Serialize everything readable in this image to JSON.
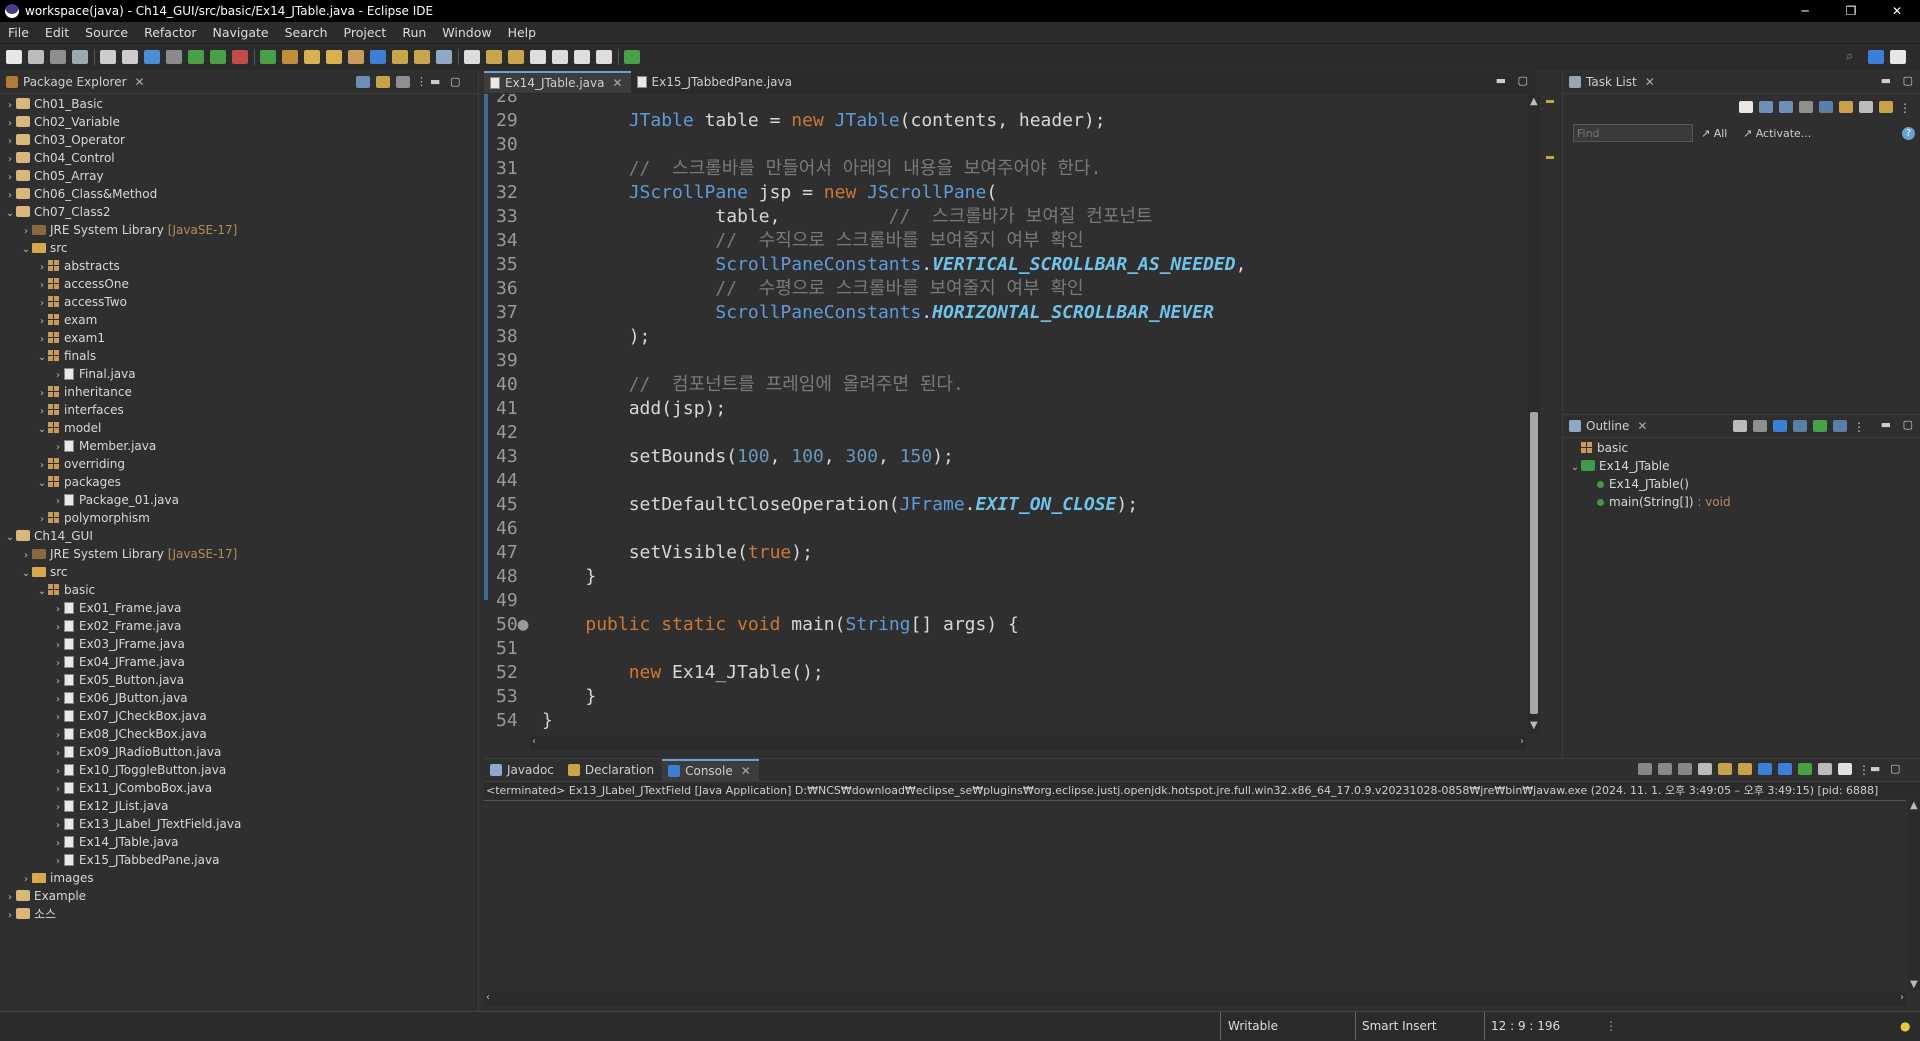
{
  "window": {
    "title": "workspace(java) - Ch14_GUI/src/basic/Ex14_JTable.java - Eclipse IDE",
    "minimize": "─",
    "restore": "❐",
    "close": "✕"
  },
  "menu": [
    "File",
    "Edit",
    "Source",
    "Refactor",
    "Navigate",
    "Search",
    "Project",
    "Run",
    "Window",
    "Help"
  ],
  "package_explorer": {
    "title": "Package Explorer",
    "rows": [
      {
        "indent": 0,
        "arrow": "›",
        "icon": "proj",
        "label": "Ch01_Basic"
      },
      {
        "indent": 0,
        "arrow": "›",
        "icon": "proj",
        "label": "Ch02_Variable"
      },
      {
        "indent": 0,
        "arrow": "›",
        "icon": "proj",
        "label": "Ch03_Operator"
      },
      {
        "indent": 0,
        "arrow": "›",
        "icon": "proj",
        "label": "Ch04_Control"
      },
      {
        "indent": 0,
        "arrow": "›",
        "icon": "proj",
        "label": "Ch05_Array"
      },
      {
        "indent": 0,
        "arrow": "›",
        "icon": "proj",
        "label": "Ch06_Class&Method"
      },
      {
        "indent": 0,
        "arrow": "⌄",
        "icon": "proj",
        "label": "Ch07_Class2"
      },
      {
        "indent": 1,
        "arrow": "›",
        "icon": "lib",
        "label": "JRE System Library",
        "suffix": "[JavaSE-17]"
      },
      {
        "indent": 1,
        "arrow": "⌄",
        "icon": "folder",
        "label": "src"
      },
      {
        "indent": 2,
        "arrow": "›",
        "icon": "pkg",
        "label": "abstracts"
      },
      {
        "indent": 2,
        "arrow": "›",
        "icon": "pkg",
        "label": "accessOne"
      },
      {
        "indent": 2,
        "arrow": "›",
        "icon": "pkg",
        "label": "accessTwo"
      },
      {
        "indent": 2,
        "arrow": "›",
        "icon": "pkg",
        "label": "exam"
      },
      {
        "indent": 2,
        "arrow": "›",
        "icon": "pkg",
        "label": "exam1"
      },
      {
        "indent": 2,
        "arrow": "⌄",
        "icon": "pkg",
        "label": "finals"
      },
      {
        "indent": 3,
        "arrow": "›",
        "icon": "java",
        "label": "Final.java"
      },
      {
        "indent": 2,
        "arrow": "›",
        "icon": "pkg",
        "label": "inheritance"
      },
      {
        "indent": 2,
        "arrow": "›",
        "icon": "pkg",
        "label": "interfaces"
      },
      {
        "indent": 2,
        "arrow": "⌄",
        "icon": "pkg",
        "label": "model"
      },
      {
        "indent": 3,
        "arrow": "›",
        "icon": "java",
        "label": "Member.java"
      },
      {
        "indent": 2,
        "arrow": "›",
        "icon": "pkg",
        "label": "overriding"
      },
      {
        "indent": 2,
        "arrow": "⌄",
        "icon": "pkg",
        "label": "packages"
      },
      {
        "indent": 3,
        "arrow": "›",
        "icon": "java",
        "label": "Package_01.java"
      },
      {
        "indent": 2,
        "arrow": "›",
        "icon": "pkg",
        "label": "polymorphism"
      },
      {
        "indent": 0,
        "arrow": "⌄",
        "icon": "proj",
        "label": "Ch14_GUI"
      },
      {
        "indent": 1,
        "arrow": "›",
        "icon": "lib",
        "label": "JRE System Library",
        "suffix": "[JavaSE-17]"
      },
      {
        "indent": 1,
        "arrow": "⌄",
        "icon": "folder",
        "label": "src"
      },
      {
        "indent": 2,
        "arrow": "⌄",
        "icon": "pkg",
        "label": "basic"
      },
      {
        "indent": 3,
        "arrow": "›",
        "icon": "java",
        "label": "Ex01_Frame.java"
      },
      {
        "indent": 3,
        "arrow": "›",
        "icon": "java",
        "label": "Ex02_Frame.java"
      },
      {
        "indent": 3,
        "arrow": "›",
        "icon": "java",
        "label": "Ex03_JFrame.java"
      },
      {
        "indent": 3,
        "arrow": "›",
        "icon": "java",
        "label": "Ex04_JFrame.java"
      },
      {
        "indent": 3,
        "arrow": "›",
        "icon": "java",
        "label": "Ex05_Button.java"
      },
      {
        "indent": 3,
        "arrow": "›",
        "icon": "java",
        "label": "Ex06_JButton.java"
      },
      {
        "indent": 3,
        "arrow": "›",
        "icon": "java",
        "label": "Ex07_JCheckBox.java"
      },
      {
        "indent": 3,
        "arrow": "›",
        "icon": "java",
        "label": "Ex08_JCheckBox.java"
      },
      {
        "indent": 3,
        "arrow": "›",
        "icon": "java",
        "label": "Ex09_JRadioButton.java"
      },
      {
        "indent": 3,
        "arrow": "›",
        "icon": "java",
        "label": "Ex10_JToggleButton.java"
      },
      {
        "indent": 3,
        "arrow": "›",
        "icon": "java",
        "label": "Ex11_JComboBox.java"
      },
      {
        "indent": 3,
        "arrow": "›",
        "icon": "java",
        "label": "Ex12_JList.java"
      },
      {
        "indent": 3,
        "arrow": "›",
        "icon": "java",
        "label": "Ex13_JLabel_JTextField.java"
      },
      {
        "indent": 3,
        "arrow": "›",
        "icon": "java",
        "label": "Ex14_JTable.java"
      },
      {
        "indent": 3,
        "arrow": "›",
        "icon": "java",
        "label": "Ex15_JTabbedPane.java"
      },
      {
        "indent": 1,
        "arrow": "›",
        "icon": "folder",
        "label": "images"
      },
      {
        "indent": 0,
        "arrow": "›",
        "icon": "proj",
        "label": "Example"
      },
      {
        "indent": 0,
        "arrow": "›",
        "icon": "proj",
        "label": "소스"
      }
    ]
  },
  "editor": {
    "tabs": [
      {
        "label": "Ex14_JTable.java",
        "active": true,
        "close": "✕"
      },
      {
        "label": "Ex15_JTabbedPane.java",
        "active": false
      }
    ],
    "lines": [
      {
        "n": "28",
        "code": []
      },
      {
        "n": "29",
        "code": [
          [
            "",
            "        "
          ],
          [
            "ty",
            "JTable"
          ],
          [
            "vr",
            " table = "
          ],
          [
            "kw",
            "new"
          ],
          [
            "vr",
            " "
          ],
          [
            "ty",
            "JTable"
          ],
          [
            "vr",
            "(contents, header);"
          ]
        ]
      },
      {
        "n": "30",
        "code": []
      },
      {
        "n": "31",
        "code": [
          [
            "",
            "        "
          ],
          [
            "cm",
            "//  스크롤바를 만들어서 아래의 내용을 보여주어야 한다."
          ]
        ]
      },
      {
        "n": "32",
        "code": [
          [
            "",
            "        "
          ],
          [
            "ty",
            "JScrollPane"
          ],
          [
            "vr",
            " jsp = "
          ],
          [
            "kw",
            "new"
          ],
          [
            "vr",
            " "
          ],
          [
            "ty",
            "JScrollPane"
          ],
          [
            "vr",
            "("
          ]
        ]
      },
      {
        "n": "33",
        "code": [
          [
            "",
            "                "
          ],
          [
            "vr",
            "table,          "
          ],
          [
            "cm",
            "//  스크롤바가 보여질 컨포넌트"
          ]
        ]
      },
      {
        "n": "34",
        "code": [
          [
            "",
            "                "
          ],
          [
            "cm",
            "//  수직으로 스크롤바를 보여줄지 여부 확인"
          ]
        ]
      },
      {
        "n": "35",
        "code": [
          [
            "",
            "                "
          ],
          [
            "ty",
            "ScrollPaneConstants"
          ],
          [
            "vr",
            "."
          ],
          [
            "fld",
            "VERTICAL_SCROLLBAR_AS_NEEDED"
          ],
          [
            "vr",
            ","
          ]
        ]
      },
      {
        "n": "36",
        "code": [
          [
            "",
            "                "
          ],
          [
            "cm",
            "//  수평으로 스크롤바를 보여줄지 여부 확인"
          ]
        ]
      },
      {
        "n": "37",
        "code": [
          [
            "",
            "                "
          ],
          [
            "ty",
            "ScrollPaneConstants"
          ],
          [
            "vr",
            "."
          ],
          [
            "fld",
            "HORIZONTAL_SCROLLBAR_NEVER"
          ]
        ]
      },
      {
        "n": "38",
        "code": [
          [
            "",
            "        "
          ],
          [
            "vr",
            ");"
          ]
        ]
      },
      {
        "n": "39",
        "code": []
      },
      {
        "n": "40",
        "code": [
          [
            "",
            "        "
          ],
          [
            "cm",
            "//  컴포넌트를 프레임에 올려주면 된다."
          ]
        ]
      },
      {
        "n": "41",
        "code": [
          [
            "",
            "        "
          ],
          [
            "vr",
            "add(jsp);"
          ]
        ]
      },
      {
        "n": "42",
        "code": []
      },
      {
        "n": "43",
        "code": [
          [
            "",
            "        "
          ],
          [
            "vr",
            "setBounds("
          ],
          [
            "num",
            "100"
          ],
          [
            "vr",
            ", "
          ],
          [
            "num",
            "100"
          ],
          [
            "vr",
            ", "
          ],
          [
            "num",
            "300"
          ],
          [
            "vr",
            ", "
          ],
          [
            "num",
            "150"
          ],
          [
            "vr",
            ");"
          ]
        ]
      },
      {
        "n": "44",
        "code": []
      },
      {
        "n": "45",
        "code": [
          [
            "",
            "        "
          ],
          [
            "vr",
            "setDefaultCloseOperation("
          ],
          [
            "ty",
            "JFrame"
          ],
          [
            "vr",
            "."
          ],
          [
            "fld",
            "EXIT_ON_CLOSE"
          ],
          [
            "vr",
            ");"
          ]
        ]
      },
      {
        "n": "46",
        "code": []
      },
      {
        "n": "47",
        "code": [
          [
            "",
            "        "
          ],
          [
            "vr",
            "setVisible("
          ],
          [
            "kw",
            "true"
          ],
          [
            "vr",
            ");"
          ]
        ]
      },
      {
        "n": "48",
        "code": [
          [
            "",
            "    "
          ],
          [
            "vr",
            "}"
          ]
        ]
      },
      {
        "n": "49",
        "code": []
      },
      {
        "n": "50●",
        "code": [
          [
            "",
            "    "
          ],
          [
            "kw",
            "public static void"
          ],
          [
            "vr",
            " main("
          ],
          [
            "ty",
            "String"
          ],
          [
            "vr",
            "[] args) {"
          ]
        ]
      },
      {
        "n": "51",
        "code": []
      },
      {
        "n": "52",
        "code": [
          [
            "",
            "        "
          ],
          [
            "kw",
            "new"
          ],
          [
            "vr",
            " Ex14_JTable();"
          ]
        ]
      },
      {
        "n": "53",
        "code": [
          [
            "",
            "    "
          ],
          [
            "vr",
            "}"
          ]
        ]
      },
      {
        "n": "54",
        "code": [
          [
            "",
            "}"
          ]
        ]
      }
    ]
  },
  "task_list": {
    "title": "Task List",
    "find_placeholder": "Find",
    "all_label": "All",
    "activate_label": "Activate..."
  },
  "outline": {
    "title": "Outline",
    "items": [
      {
        "indent": 0,
        "label": "basic",
        "type": ""
      },
      {
        "indent": 0,
        "label": "Ex14_JTable",
        "type": "",
        "arrow": "⌄"
      },
      {
        "indent": 1,
        "label": "Ex14_JTable()",
        "type": ""
      },
      {
        "indent": 1,
        "label": "main(String[])",
        "type": " : void"
      }
    ]
  },
  "bottom": {
    "tabs": [
      {
        "label": "Javadoc",
        "active": false
      },
      {
        "label": "Declaration",
        "active": false
      },
      {
        "label": "Console",
        "active": true,
        "close": "✕"
      }
    ],
    "console_header": "<terminated> Ex13_JLabel_JTextField [Java Application] D:₩NCS₩download₩eclipse_se₩plugins₩org.eclipse.justj.openjdk.hotspot.jre.full.win32.x86_64_17.0.9.v20231028-0858₩jre₩bin₩javaw.exe  (2024. 11. 1. 오후 3:49:05 – 오후 3:49:15) [pid: 6888]"
  },
  "status": {
    "writable": "Writable",
    "insert_mode": "Smart Insert",
    "position": "12 : 9 : 196"
  }
}
